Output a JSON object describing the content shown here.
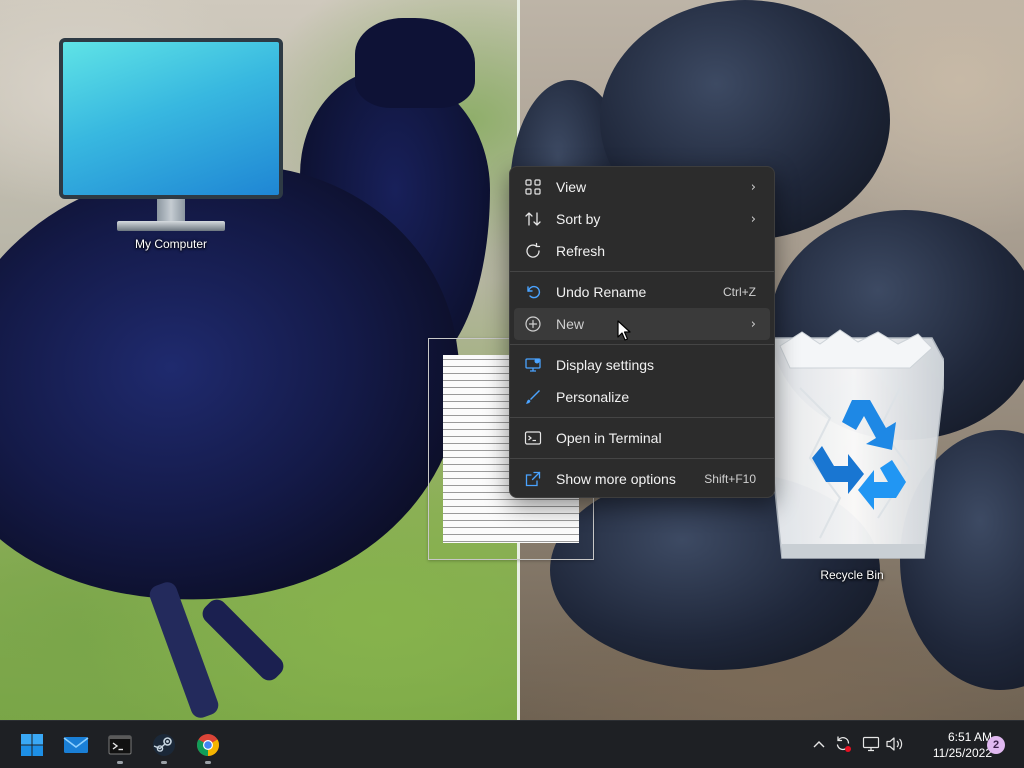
{
  "desktop": {
    "icons": [
      {
        "label": "My Computer",
        "icon": "monitor-icon"
      },
      {
        "label": "",
        "icon": "text-file-icon"
      },
      {
        "label": "Recycle Bin",
        "icon": "recycle-bin-icon"
      }
    ]
  },
  "context_menu": {
    "items": [
      {
        "label": "View",
        "icon": "grid-icon",
        "submenu": true
      },
      {
        "label": "Sort by",
        "icon": "sort-icon",
        "submenu": true
      },
      {
        "label": "Refresh",
        "icon": "refresh-icon"
      },
      {
        "label": "Undo Rename",
        "icon": "undo-icon",
        "shortcut": "Ctrl+Z"
      },
      {
        "label": "New",
        "icon": "plus-circle-icon",
        "submenu": true,
        "hovered": true
      },
      {
        "label": "Display settings",
        "icon": "display-settings-icon"
      },
      {
        "label": "Personalize",
        "icon": "brush-icon"
      },
      {
        "label": "Open in Terminal",
        "icon": "terminal-icon"
      },
      {
        "label": "Show more options",
        "icon": "share-icon",
        "shortcut": "Shift+F10"
      }
    ],
    "chevron": "›"
  },
  "taskbar": {
    "apps": [
      {
        "name": "Start",
        "icon": "windows-start-icon"
      },
      {
        "name": "Mail",
        "icon": "mail-icon"
      },
      {
        "name": "Terminal",
        "icon": "terminal-app-icon",
        "running": true
      },
      {
        "name": "Steam",
        "icon": "steam-icon",
        "running": true
      },
      {
        "name": "Chrome",
        "icon": "chrome-icon",
        "running": true
      }
    ],
    "tray": {
      "icons": [
        "chevron-up-icon",
        "sync-icon",
        "network-icon",
        "volume-icon"
      ],
      "time": "6:51 AM",
      "date": "11/25/2022",
      "notifications": "2"
    }
  },
  "colors": {
    "menu_bg": "#2c2c2c",
    "taskbar_bg": "#1e2024",
    "accent": "#0078d4"
  }
}
